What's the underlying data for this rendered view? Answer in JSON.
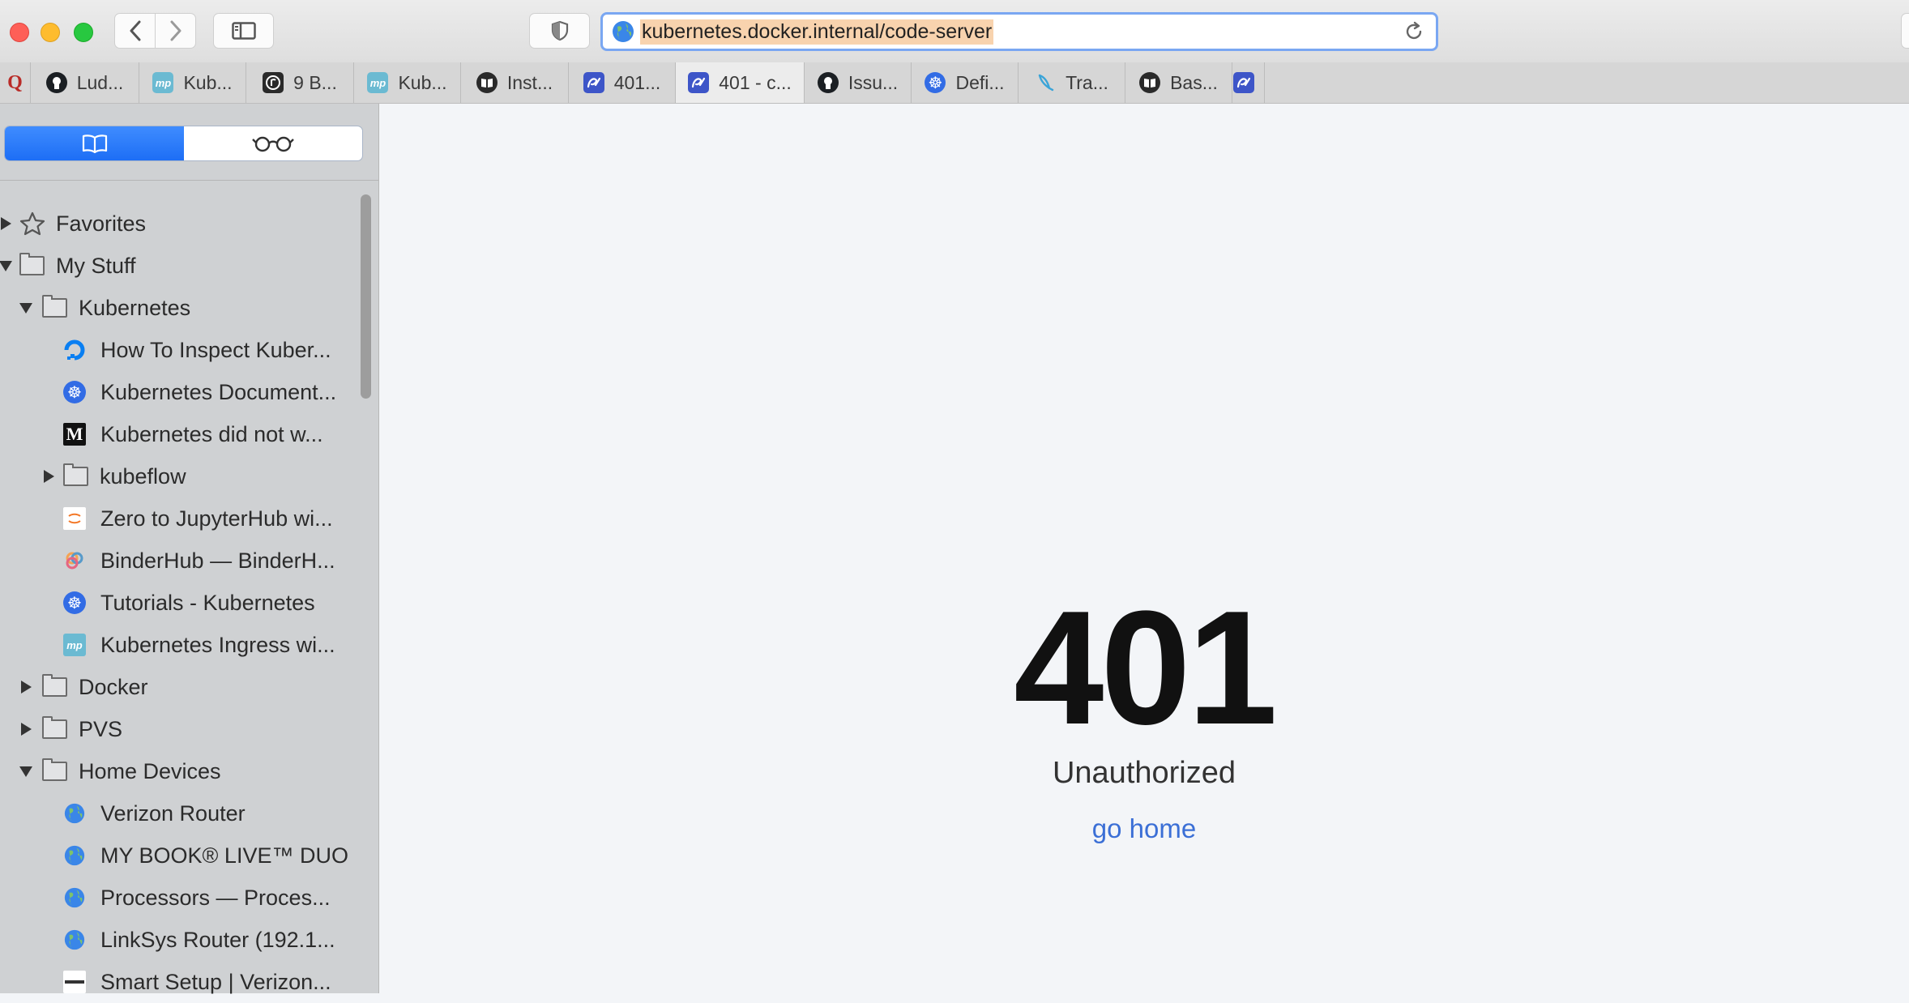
{
  "browser": {
    "url": "kubernetes.docker.internal/code-server"
  },
  "tabs": [
    {
      "label": "",
      "icon": "quora-icon",
      "color": "#b92b27",
      "glyph": "Q"
    },
    {
      "label": "Lud...",
      "icon": "github-icon",
      "color": "#1b1f23",
      "glyph": ""
    },
    {
      "label": "Kub...",
      "icon": "mp-icon",
      "color": "#6bbad2",
      "glyph": "mp"
    },
    {
      "label": "9 B...",
      "icon": "circle-r-icon",
      "color": "#2a2a2a",
      "glyph": "r"
    },
    {
      "label": "Kub...",
      "icon": "mp-icon",
      "color": "#6bbad2",
      "glyph": "mp"
    },
    {
      "label": "Inst...",
      "icon": "book-dark-icon",
      "color": "#2a2a2a",
      "glyph": ""
    },
    {
      "label": "401...",
      "icon": "code-server-icon",
      "color": "#3d55c8",
      "glyph": "cs"
    },
    {
      "label": "401 - c...",
      "icon": "code-server-icon",
      "color": "#3d55c8",
      "glyph": "cs",
      "active": true
    },
    {
      "label": "Issu...",
      "icon": "github-icon",
      "color": "#1b1f23",
      "glyph": ""
    },
    {
      "label": "Defi...",
      "icon": "kubernetes-icon",
      "color": "#326ce5",
      "glyph": "☸"
    },
    {
      "label": "Tra...",
      "icon": "feather-icon",
      "color": "#3aa4d8",
      "glyph": ""
    },
    {
      "label": "Bas...",
      "icon": "book-dark-icon",
      "color": "#2a2a2a",
      "glyph": ""
    },
    {
      "label": "",
      "icon": "code-server-icon",
      "color": "#3d55c8",
      "glyph": "cs"
    }
  ],
  "sidebar": {
    "items": [
      {
        "label": "Favorites",
        "kind": "star",
        "level": 0,
        "state": "collapsed"
      },
      {
        "label": "My Stuff",
        "kind": "folder",
        "level": 0,
        "state": "expanded"
      },
      {
        "label": "Kubernetes",
        "kind": "folder",
        "level": 1,
        "state": "expanded"
      },
      {
        "label": "How To Inspect Kuber...",
        "kind": "bookmark",
        "level": 2,
        "icon": "digitalocean-icon"
      },
      {
        "label": "Kubernetes Document...",
        "kind": "bookmark",
        "level": 2,
        "icon": "kubernetes-icon"
      },
      {
        "label": "Kubernetes did not w...",
        "kind": "bookmark",
        "level": 2,
        "icon": "medium-icon"
      },
      {
        "label": "kubeflow",
        "kind": "folder",
        "level": 2,
        "state": "collapsed"
      },
      {
        "label": "Zero to JupyterHub wi...",
        "kind": "bookmark",
        "level": 2,
        "icon": "jupyter-icon"
      },
      {
        "label": "BinderHub — BinderH...",
        "kind": "bookmark",
        "level": 2,
        "icon": "binder-icon"
      },
      {
        "label": "Tutorials - Kubernetes",
        "kind": "bookmark",
        "level": 2,
        "icon": "kubernetes-icon"
      },
      {
        "label": "Kubernetes Ingress wi...",
        "kind": "bookmark",
        "level": 2,
        "icon": "mp-icon"
      },
      {
        "label": "Docker",
        "kind": "folder",
        "level": 1,
        "state": "collapsed"
      },
      {
        "label": "PVS",
        "kind": "folder",
        "level": 1,
        "state": "collapsed"
      },
      {
        "label": "Home Devices",
        "kind": "folder",
        "level": 1,
        "state": "expanded"
      },
      {
        "label": "Verizon Router",
        "kind": "bookmark",
        "level": 2,
        "icon": "globe-icon"
      },
      {
        "label": "MY BOOK® LIVE™ DUO",
        "kind": "bookmark",
        "level": 2,
        "icon": "globe-icon"
      },
      {
        "label": "Processors — Proces...",
        "kind": "bookmark",
        "level": 2,
        "icon": "globe-icon"
      },
      {
        "label": "LinkSys Router (192.1...",
        "kind": "bookmark",
        "level": 2,
        "icon": "globe-icon"
      },
      {
        "label": "Smart Setup | Verizon...",
        "kind": "bookmark",
        "level": 2,
        "icon": "verizon-icon"
      }
    ]
  },
  "page": {
    "code": "401",
    "message": "Unauthorized",
    "link": "go home"
  }
}
